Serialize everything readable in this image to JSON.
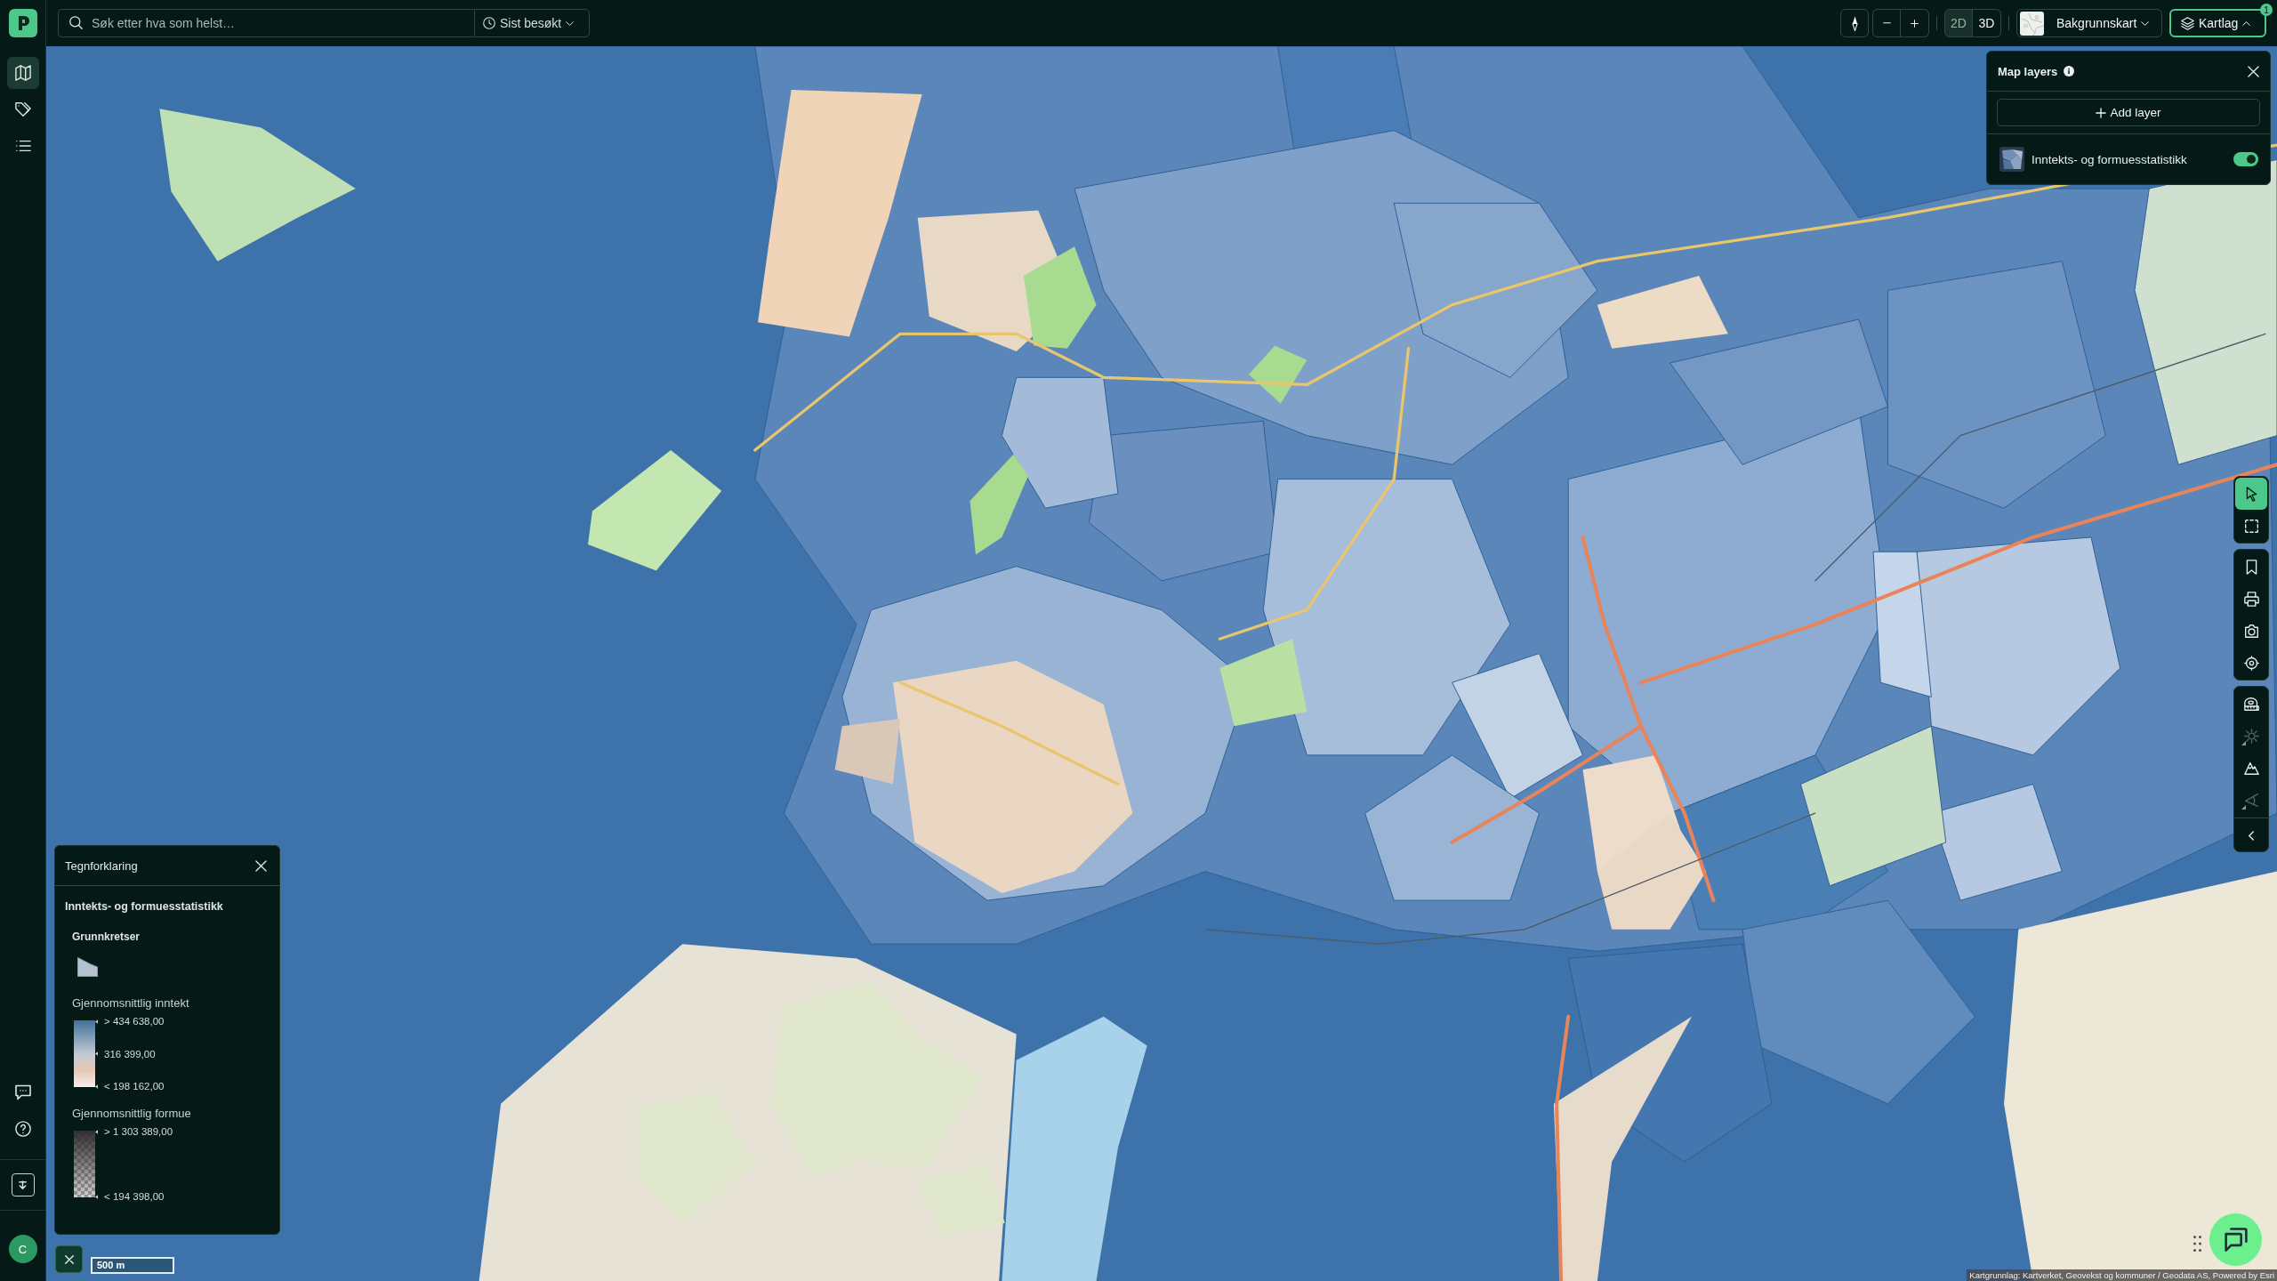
{
  "app_bar": {
    "search": {
      "placeholder": "Søk etter hva som helst…"
    },
    "recent_button": {
      "label": "Sist besøkt"
    }
  },
  "sidebar": {
    "items": [
      {
        "kind": "map",
        "selected": true
      },
      {
        "kind": "tags",
        "selected": false
      },
      {
        "kind": "list",
        "selected": false
      }
    ],
    "user": {
      "initial": "C"
    }
  },
  "map_controls": {
    "view_modes": [
      {
        "label": "2D",
        "selected": true
      },
      {
        "label": "3D",
        "selected": false
      }
    ],
    "basemap_button": {
      "label": "Bakgrunnskart"
    },
    "layers_button": {
      "label": "Kartlag",
      "expanded": true,
      "badge": "1"
    }
  },
  "layers_panel": {
    "title": "Map layers",
    "add_button": "Add layer",
    "layers": [
      {
        "name": "Inntekts- og formuesstatistikk",
        "on": true
      }
    ]
  },
  "toolbar": {
    "groups": [
      {
        "tools": [
          {
            "kind": "pointer",
            "selected": true,
            "disabled": false,
            "has_menu": false
          },
          {
            "kind": "box_select",
            "selected": false,
            "disabled": false,
            "has_menu": false
          }
        ]
      },
      {
        "tools": [
          {
            "kind": "bookmark",
            "selected": false,
            "disabled": false,
            "has_menu": false
          },
          {
            "kind": "print",
            "selected": false,
            "disabled": false,
            "has_menu": false
          },
          {
            "kind": "camera",
            "selected": false,
            "disabled": false,
            "has_menu": false
          },
          {
            "kind": "locate",
            "selected": false,
            "disabled": false,
            "has_menu": false
          }
        ]
      },
      {
        "tools": [
          {
            "kind": "measure",
            "selected": false,
            "disabled": false,
            "has_menu": false
          },
          {
            "kind": "sun",
            "selected": false,
            "disabled": true,
            "has_menu": true
          },
          {
            "kind": "terrain",
            "selected": false,
            "disabled": false,
            "has_menu": false
          },
          {
            "kind": "angle",
            "selected": false,
            "disabled": true,
            "has_menu": true
          }
        ]
      }
    ]
  },
  "legend": {
    "title": "Tegnforklaring",
    "layer": "Inntekts- og formuesstatistikk",
    "groups": [
      {
        "kind": "polygon",
        "title": "Grunnkretser"
      },
      {
        "kind": "color_ramp",
        "title": "Gjennomsnittlig inntekt",
        "stops": [
          "> 434 638,00",
          "316 399,00",
          "< 198 162,00"
        ]
      },
      {
        "kind": "opacity_ramp",
        "title": "Gjennomsnittlig formue",
        "stops": [
          "> 1 303 389,00",
          "< 194 398,00"
        ]
      }
    ]
  },
  "scale_bar": {
    "label": "500 m"
  },
  "attribution": "Kartgrunnlag: Kartverket, Geovekst og kommuner / Geodata AS, Powered by Esri"
}
